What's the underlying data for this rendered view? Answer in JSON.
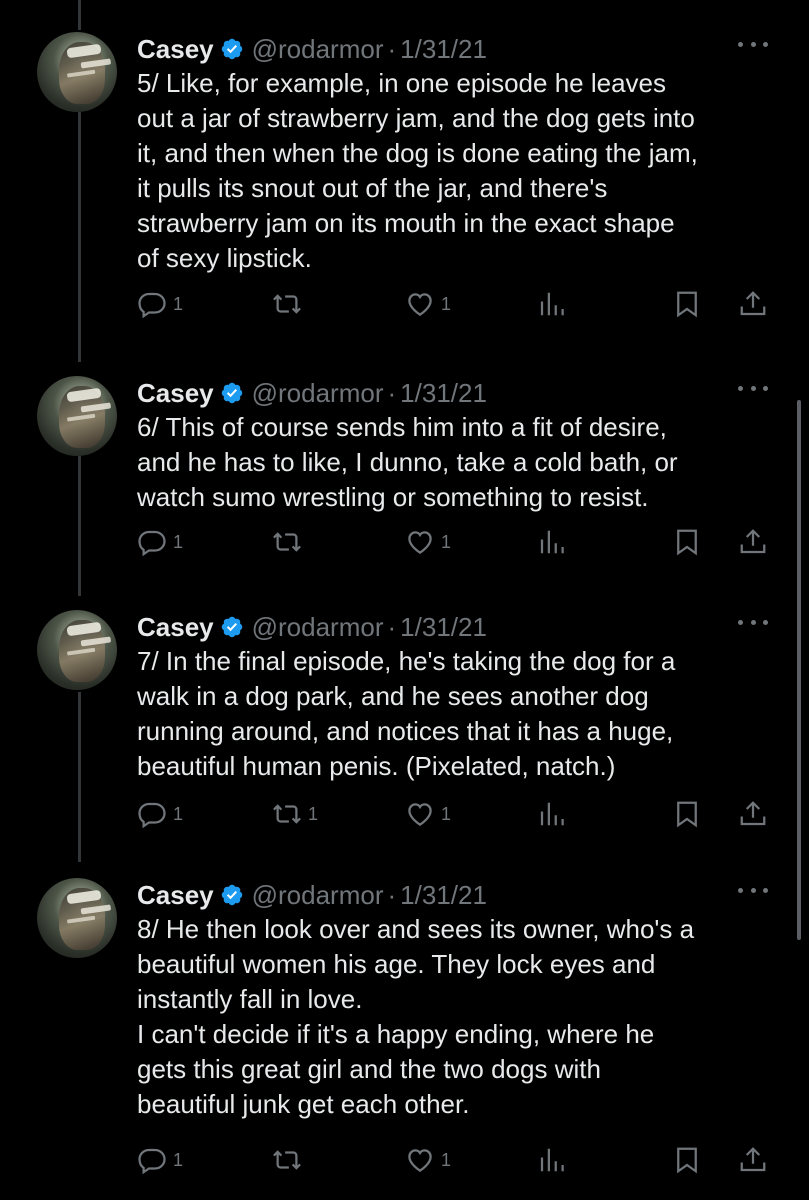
{
  "tweets": [
    {
      "name": "Casey",
      "handle": "@rodarmor",
      "separator": "·",
      "date": "1/31/21",
      "text": "5/ Like, for example, in one episode he leaves\nout a jar of strawberry jam, and the dog gets into\nit, and then when the dog is done eating the jam,\nit pulls its snout out of the jar, and there's\nstrawberry jam on its mouth in the exact shape\nof sexy lipstick.",
      "replies": "1",
      "retweets": "",
      "likes": "1"
    },
    {
      "name": "Casey",
      "handle": "@rodarmor",
      "separator": "·",
      "date": "1/31/21",
      "text": "6/ This of course sends him into a fit of desire,\nand he has to like, I dunno, take a cold bath, or\nwatch sumo wrestling or something to resist.",
      "replies": "1",
      "retweets": "",
      "likes": "1"
    },
    {
      "name": "Casey",
      "handle": "@rodarmor",
      "separator": "·",
      "date": "1/31/21",
      "text": "7/ In the final episode, he's taking the dog for a\nwalk in a dog park, and he sees another dog\nrunning around, and notices that it has a huge,\nbeautiful human penis. (Pixelated, natch.)",
      "replies": "1",
      "retweets": "1",
      "likes": "1"
    },
    {
      "name": "Casey",
      "handle": "@rodarmor",
      "separator": "·",
      "date": "1/31/21",
      "text": "8/ He then look over and sees its owner, who's a\nbeautiful women his age. They lock eyes and\ninstantly fall in love.\nI can't decide if it's a happy ending, where he\ngets this great girl and the two dogs with\nbeautiful junk get each other.",
      "replies": "1",
      "retweets": "",
      "likes": "1"
    }
  ],
  "icons": {
    "verified": "verified-badge-icon",
    "more": "more-options-icon",
    "reply": "reply-icon",
    "retweet": "retweet-icon",
    "like": "like-icon",
    "views": "views-icon",
    "bookmark": "bookmark-icon",
    "share": "share-icon"
  },
  "colors": {
    "background": "#000000",
    "text": "#e7e9ea",
    "secondary": "#71767b",
    "verified": "#1d9bf0",
    "thread_line": "#333639"
  }
}
